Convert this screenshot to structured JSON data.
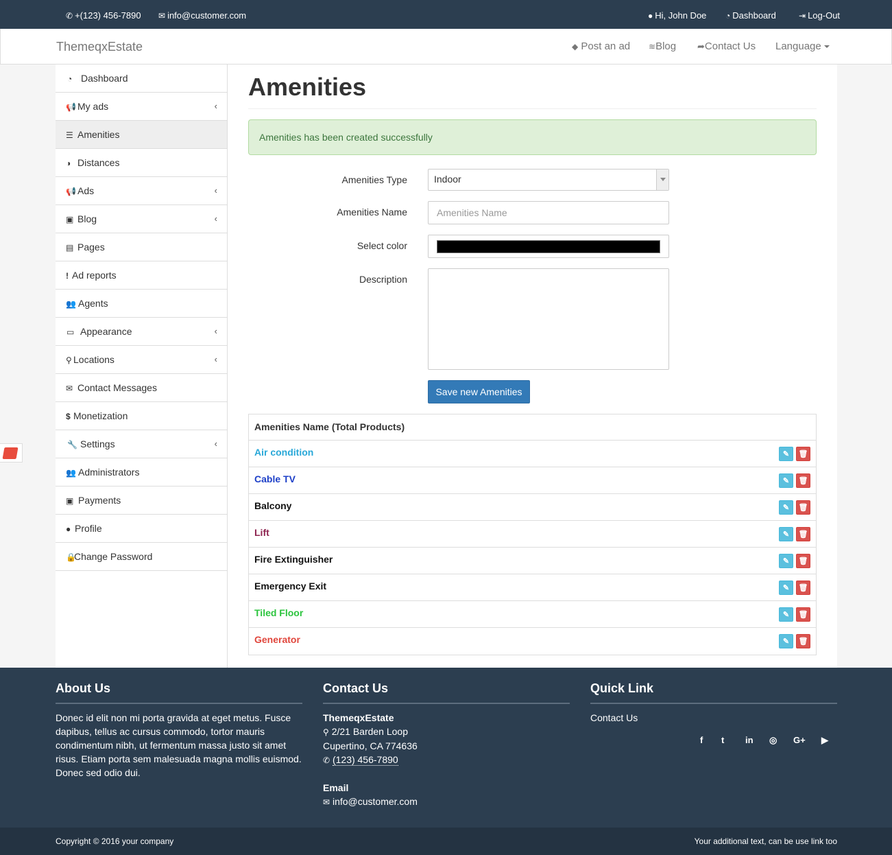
{
  "topbar": {
    "phone": "+(123) 456-7890",
    "email": "info@customer.com",
    "greeting": "Hi, John Doe",
    "dashboard": "Dashboard",
    "logout": "Log-Out"
  },
  "navbar": {
    "brand": "ThemeqxEstate",
    "post_ad": "Post an ad",
    "blog": "Blog",
    "contact": "Contact Us",
    "language": "Language"
  },
  "sidebar": {
    "items": [
      {
        "label": "Dashboard"
      },
      {
        "label": "My ads"
      },
      {
        "label": "Amenities"
      },
      {
        "label": "Distances"
      },
      {
        "label": "Ads"
      },
      {
        "label": "Blog"
      },
      {
        "label": "Pages"
      },
      {
        "label": "Ad reports"
      },
      {
        "label": "Agents"
      },
      {
        "label": "Appearance"
      },
      {
        "label": "Locations"
      },
      {
        "label": "Contact Messages"
      },
      {
        "label": "Monetization"
      },
      {
        "label": "Settings"
      },
      {
        "label": "Administrators"
      },
      {
        "label": "Payments"
      },
      {
        "label": "Profile"
      },
      {
        "label": "Change Password"
      }
    ]
  },
  "main": {
    "title": "Amenities",
    "alert": "Amenities has been created successfully",
    "form": {
      "type_label": "Amenities Type",
      "type_value": "Indoor",
      "name_label": "Amenities Name",
      "name_placeholder": "Amenities Name",
      "color_label": "Select color",
      "color_value": "#000000",
      "description_label": "Description",
      "save_label": "Save new Amenities"
    },
    "table": {
      "header": "Amenities Name (Total Products)",
      "rows": [
        {
          "name": "Air condition",
          "color": "#29a8d8"
        },
        {
          "name": "Cable TV",
          "color": "#1e40c8"
        },
        {
          "name": "Balcony",
          "color": "#111111"
        },
        {
          "name": "Lift",
          "color": "#8e2550"
        },
        {
          "name": "Fire Extinguisher",
          "color": "#111111"
        },
        {
          "name": "Emergency Exit",
          "color": "#111111"
        },
        {
          "name": "Tiled Floor",
          "color": "#2cc43e"
        },
        {
          "name": "Generator",
          "color": "#e0463c"
        }
      ]
    }
  },
  "footer": {
    "about_title": "About Us",
    "about_text": "Donec id elit non mi porta gravida at eget metus. Fusce dapibus, tellus ac cursus commodo, tortor mauris condimentum nibh, ut fermentum massa justo sit amet risus. Etiam porta sem malesuada magna mollis euismod. Donec sed odio dui.",
    "contact_title": "Contact Us",
    "company": "ThemeqxEstate",
    "address1": "2/21 Barden Loop",
    "address2": "Cupertino, CA 774636",
    "phone": "(123) 456-7890",
    "email_label": "Email",
    "email": "info@customer.com",
    "quick_title": "Quick Link",
    "quick_link": "Contact Us",
    "copyright": "Copyright © 2016 your company",
    "additional": "Your additional text, can be use link too"
  }
}
